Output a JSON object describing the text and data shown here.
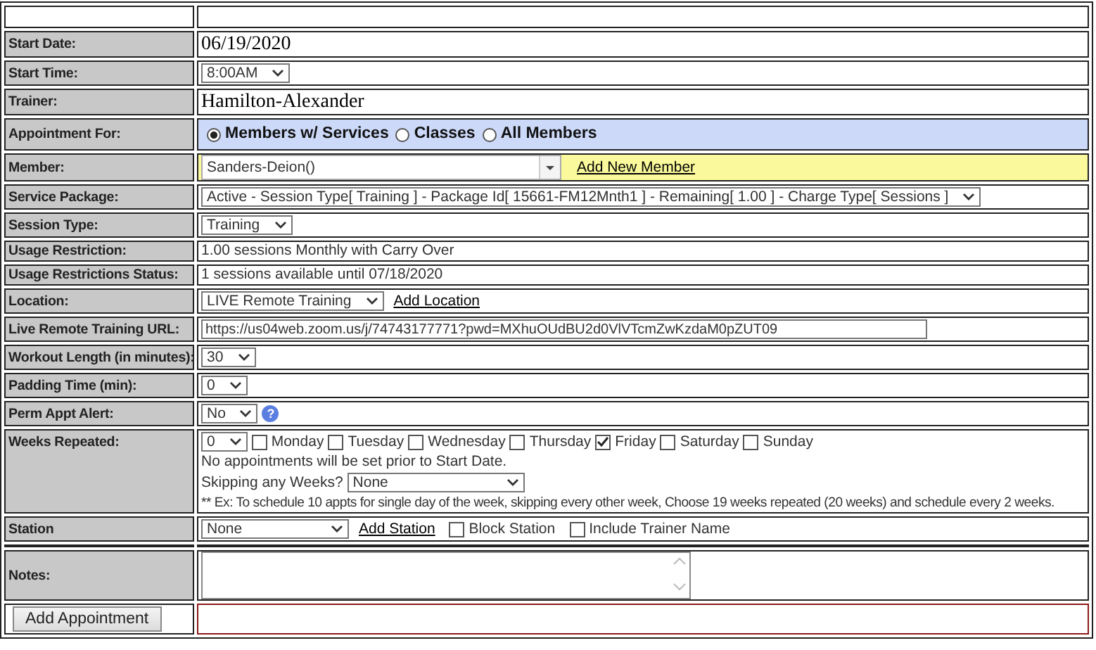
{
  "rows": [
    {
      "kind": "blank"
    },
    {
      "kind": "text",
      "label": "Start Date:",
      "value": "06/19/2020"
    },
    {
      "kind": "select",
      "label": "Start Time:",
      "value": "8:00AM"
    },
    {
      "kind": "text",
      "label": "Trainer:",
      "value": "Hamilton-Alexander"
    },
    {
      "kind": "radio",
      "label": "Appointment For:",
      "options": [
        {
          "label": "Members w/ Services",
          "selected": true
        },
        {
          "label": "Classes",
          "selected": false
        },
        {
          "label": "All Members",
          "selected": false
        }
      ]
    },
    {
      "kind": "combo",
      "label": "Member:",
      "value": "Sanders-Deion()",
      "link": "Add New Member"
    },
    {
      "kind": "select",
      "label": "Service Package:",
      "value": "Active - Session Type[ Training ] - Package Id[ 15661-FM12Mnth1 ] - Remaining[ 1.00 ] - Charge Type[ Sessions ]"
    },
    {
      "kind": "select",
      "label": "Session Type:",
      "value": "Training"
    },
    {
      "kind": "note",
      "label": "Usage Restriction:",
      "value": "1.00 sessions Monthly with Carry Over"
    },
    {
      "kind": "note",
      "label": "Usage Restrictions Status:",
      "value": "1 sessions available until 07/18/2020"
    },
    {
      "kind": "select",
      "label": "Location:",
      "value": "LIVE Remote Training",
      "link": "Add Location"
    },
    {
      "kind": "input",
      "label": "Live Remote Training URL:",
      "value": "https://us04web.zoom.us/j/74743177771?pwd=MXhuOUdBU2d0VlVTcmZwKzdaM0pZUT09"
    },
    {
      "kind": "select",
      "label": "Workout Length (in minutes):",
      "value": "30"
    },
    {
      "kind": "select",
      "label": "Padding Time (min):",
      "value": "0"
    },
    {
      "kind": "select",
      "label": "Perm Appt Alert:",
      "value": "No",
      "help": "?"
    },
    {
      "kind": "weeks",
      "label": "Weeks Repeated:",
      "value": "0",
      "days": [
        {
          "label": "Monday",
          "checked": false
        },
        {
          "label": "Tuesday",
          "checked": false
        },
        {
          "label": "Wednesday",
          "checked": false
        },
        {
          "label": "Thursday",
          "checked": false
        },
        {
          "label": "Friday",
          "checked": true
        },
        {
          "label": "Saturday",
          "checked": false
        },
        {
          "label": "Sunday",
          "checked": false
        }
      ],
      "notice": "No appointments will be set prior to Start Date.",
      "skip_label": "Skipping any Weeks?",
      "skip_value": "None",
      "example": "** Ex: To schedule 10 appts for single day of the week, skipping every other week, Choose 19 weeks repeated (20 weeks) and schedule every 2 weeks."
    },
    {
      "kind": "station",
      "label": "Station",
      "value": "None",
      "link": "Add Station",
      "checks": [
        {
          "label": "Block Station",
          "checked": false
        },
        {
          "label": "Include Trainer Name",
          "checked": false
        }
      ]
    },
    {
      "kind": "spacer"
    },
    {
      "kind": "textarea",
      "label": "Notes:"
    },
    {
      "kind": "submit",
      "button": "Add Appointment"
    }
  ]
}
